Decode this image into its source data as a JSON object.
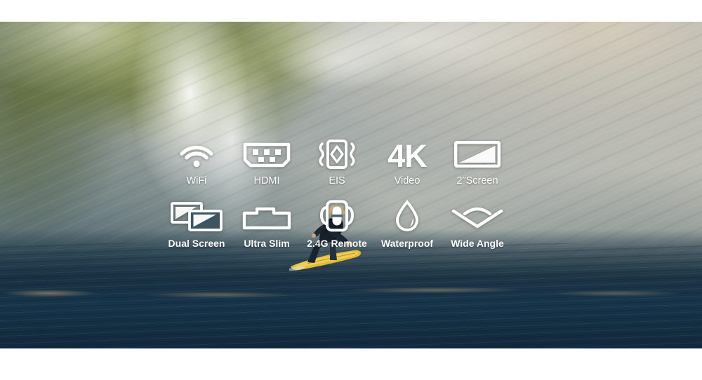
{
  "banner": {
    "background": {
      "scene": "ocean-wave-with-surfer",
      "top_band_color": "#ffffff",
      "bottom_band_color": "#ffffff",
      "wave_green": "#78842c",
      "wave_teal": "#1c3a4a",
      "ocean_navy": "#12293c",
      "haze_beige": "#cbc6b8"
    },
    "surfer": {
      "name": "surfer-on-yellow-board",
      "wetsuit_color": "#1b2430",
      "board_color": "#e8c23a",
      "hair_color": "#c8b37e"
    },
    "features": {
      "row1": [
        {
          "label": "WiFi",
          "icon": "wifi-icon"
        },
        {
          "label": "HDMI",
          "icon": "hdmi-port-icon"
        },
        {
          "label": "EIS",
          "icon": "eis-stabilization-icon"
        },
        {
          "label": "Video",
          "icon": "4k-text-icon",
          "icon_text": "4K"
        },
        {
          "label": "2″Screen",
          "icon": "screen-icon"
        }
      ],
      "row2": [
        {
          "label": "Dual Screen",
          "icon": "dual-screen-icon"
        },
        {
          "label": "Ultra Slim",
          "icon": "ultra-slim-camera-icon"
        },
        {
          "label": "2.4G Remote",
          "icon": "remote-control-icon"
        },
        {
          "label": "Waterproof",
          "icon": "water-drop-icon"
        },
        {
          "label": "Wide Angle",
          "icon": "wide-angle-icon"
        }
      ]
    },
    "label_color": "#ffffff"
  }
}
